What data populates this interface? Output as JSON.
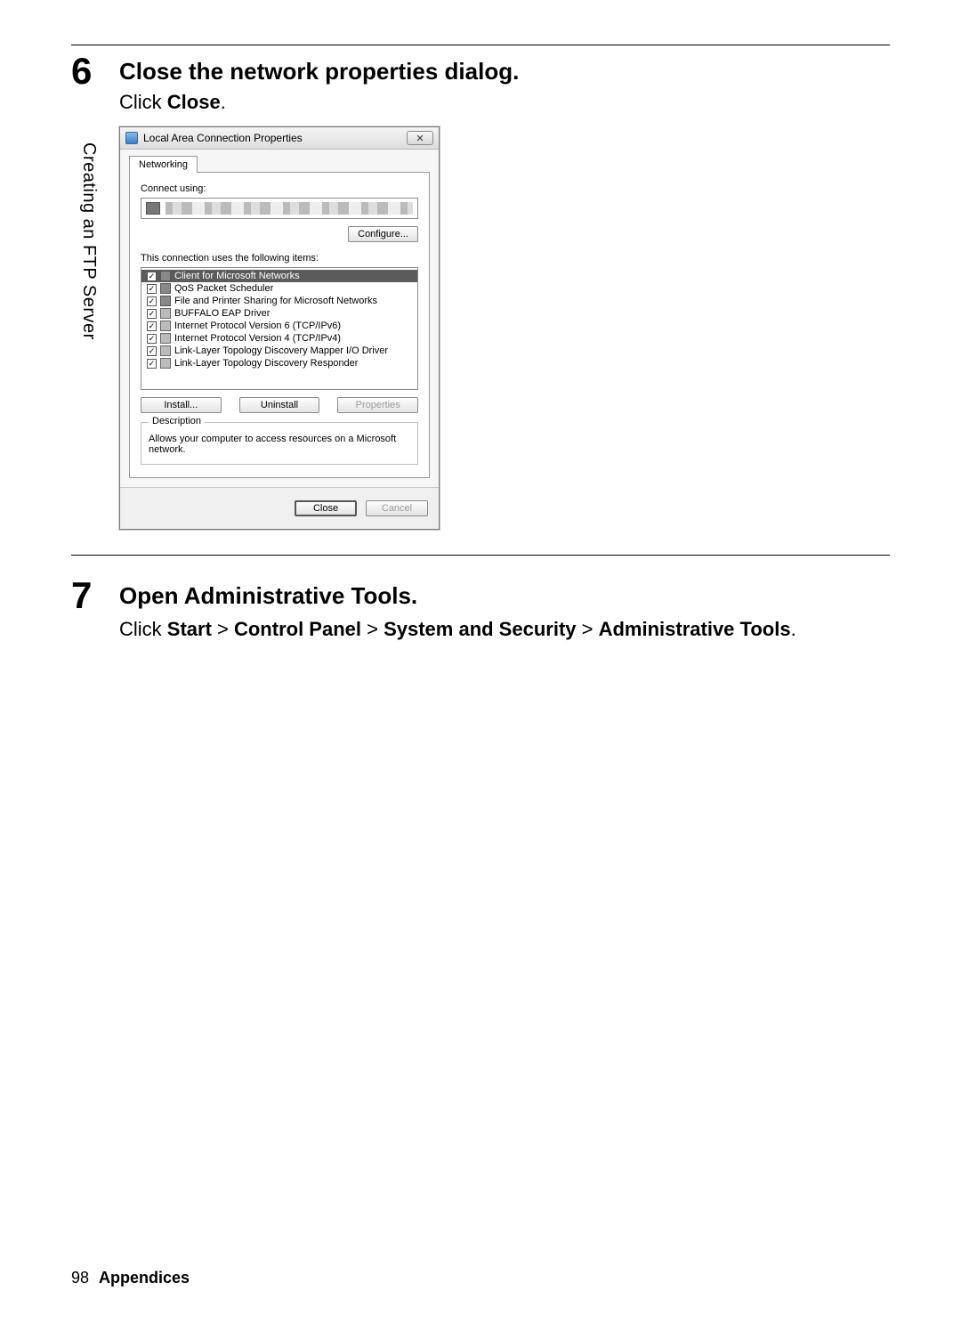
{
  "sidebar_label": "Creating an FTP Server",
  "step6": {
    "num": "6",
    "title": "Close the network properties dialog.",
    "instruction_prefix": "Click ",
    "instruction_bold": "Close",
    "instruction_suffix": "."
  },
  "dialog": {
    "title": "Local Area Connection Properties",
    "tab": "Networking",
    "connect_using_label": "Connect using:",
    "configure_btn": "Configure...",
    "items_label": "This connection uses the following items:",
    "items": [
      {
        "label": "Client for Microsoft Networks",
        "selected": true,
        "icon": "net"
      },
      {
        "label": "QoS Packet Scheduler",
        "selected": false,
        "icon": "net"
      },
      {
        "label": "File and Printer Sharing for Microsoft Networks",
        "selected": false,
        "icon": "net"
      },
      {
        "label": "BUFFALO EAP Driver",
        "selected": false,
        "icon": "drv"
      },
      {
        "label": "Internet Protocol Version 6 (TCP/IPv6)",
        "selected": false,
        "icon": "drv"
      },
      {
        "label": "Internet Protocol Version 4 (TCP/IPv4)",
        "selected": false,
        "icon": "drv"
      },
      {
        "label": "Link-Layer Topology Discovery Mapper I/O Driver",
        "selected": false,
        "icon": "drv"
      },
      {
        "label": "Link-Layer Topology Discovery Responder",
        "selected": false,
        "icon": "drv"
      }
    ],
    "install_btn": "Install...",
    "uninstall_btn": "Uninstall",
    "properties_btn": "Properties",
    "description_legend": "Description",
    "description_text": "Allows your computer to access resources on a Microsoft network.",
    "close_btn": "Close",
    "cancel_btn": "Cancel"
  },
  "step7": {
    "num": "7",
    "title": "Open Administrative Tools.",
    "path_prefix": "Click ",
    "path_parts": [
      "Start",
      "Control Panel",
      "System and Security",
      "Administrative Tools"
    ],
    "sep": " > ",
    "suffix": "."
  },
  "footer": {
    "page": "98",
    "section": "Appendices"
  }
}
